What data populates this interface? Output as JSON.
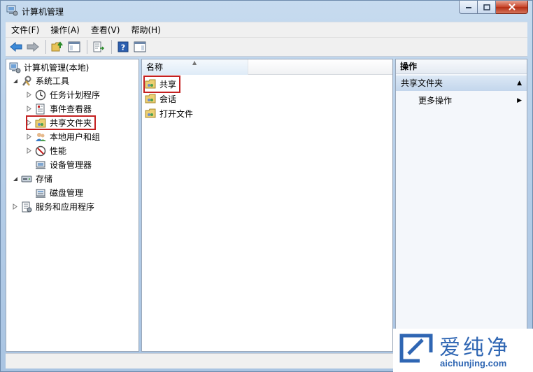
{
  "window": {
    "title": "计算机管理"
  },
  "menu": [
    "文件(F)",
    "操作(A)",
    "查看(V)",
    "帮助(H)"
  ],
  "tree": {
    "root": "计算机管理(本地)",
    "system_tools": "系统工具",
    "task_scheduler": "任务计划程序",
    "event_viewer": "事件查看器",
    "shared_folders": "共享文件夹",
    "local_users": "本地用户和组",
    "performance": "性能",
    "device_manager": "设备管理器",
    "storage": "存储",
    "disk_management": "磁盘管理",
    "services_apps": "服务和应用程序"
  },
  "list": {
    "column_name": "名称",
    "items": [
      "共享",
      "会话",
      "打开文件"
    ]
  },
  "actions": {
    "header": "操作",
    "section": "共享文件夹",
    "more": "更多操作"
  },
  "watermark": {
    "brand": "爱纯净",
    "url": "aichunjing.com"
  },
  "colors": {
    "highlight_box": "#c42020",
    "brand": "#2f66b3"
  }
}
